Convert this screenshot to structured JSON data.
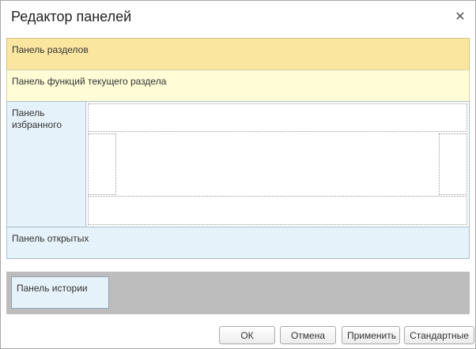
{
  "window": {
    "title": "Редактор панелей",
    "close_icon": "close-icon"
  },
  "panels": {
    "sections": "Панель разделов",
    "functions": "Панель функций текущего раздела",
    "favorites": "Панель избранного",
    "open": "Панель открытых",
    "history": "Панель истории"
  },
  "buttons": {
    "ok": "ОК",
    "cancel": "Отмена",
    "apply": "Применить",
    "default": "Стандартные"
  },
  "colors": {
    "sections_bg": "#fbe6a0",
    "functions_bg": "#fffcd6",
    "blue_panel_bg": "#e6f2f9",
    "history_area_bg": "#bdbdbd"
  }
}
